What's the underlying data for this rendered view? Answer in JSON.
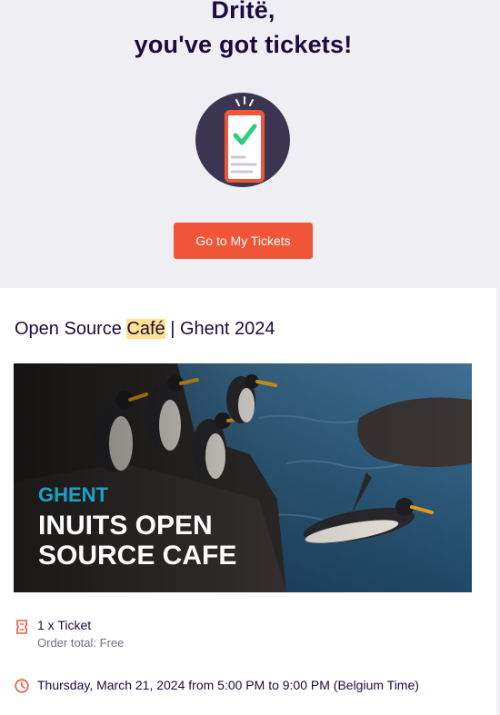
{
  "header": {
    "greeting_line1": "Dritë,",
    "greeting_line2": "you've got tickets!",
    "cta_label": "Go to My Tickets"
  },
  "event": {
    "title_prefix": "Open Source ",
    "title_highlight": "Café",
    "title_suffix": " | Ghent 2024",
    "banner": {
      "city": "GHENT",
      "line1": "INUITS OPEN",
      "line2": "SOURCE CAFE"
    }
  },
  "order": {
    "ticket_label": "1 x Ticket",
    "order_total": "Order total: Free"
  },
  "schedule": {
    "date_text": "Thursday, March 21, 2024 from 5:00 PM to 9:00 PM (Belgium Time)"
  },
  "icons": {
    "ticket_status": "ticket-check-icon",
    "ticket": "ticket-icon",
    "clock": "clock-icon"
  },
  "colors": {
    "accent": "#f05537",
    "text_dark": "#1e0a3c",
    "highlight": "#fde38f",
    "banner_city": "#1aa3c9"
  }
}
